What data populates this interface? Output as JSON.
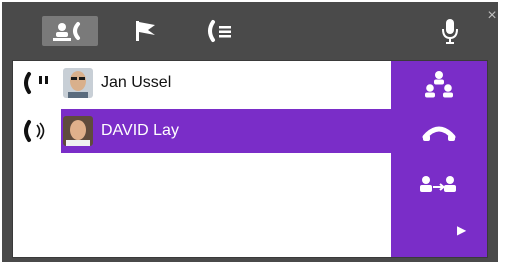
{
  "toolbar": {
    "tabs": [
      {
        "id": "contacts",
        "icon": "contacts-call-icon",
        "active": true
      },
      {
        "id": "flags",
        "icon": "flag-icon",
        "active": false
      },
      {
        "id": "call-list",
        "icon": "call-list-icon",
        "active": false
      }
    ],
    "mic_icon": "microphone-icon",
    "close_symbol": "×"
  },
  "calls": [
    {
      "name": "Jan Ussel",
      "status": "on-hold",
      "status_icon": "handset-hold-icon",
      "selected": false
    },
    {
      "name": "DAVID Lay",
      "status": "active",
      "status_icon": "handset-active-icon",
      "selected": true
    }
  ],
  "actions": [
    {
      "id": "conference",
      "icon": "conference-icon"
    },
    {
      "id": "hangup",
      "icon": "hangup-icon"
    },
    {
      "id": "transfer",
      "icon": "transfer-icon"
    },
    {
      "id": "more",
      "icon": "caret-right-icon"
    }
  ],
  "colors": {
    "accent": "#7a2dc8",
    "toolbar_bg": "#4a4a4a",
    "active_tab": "#7a7a7a"
  }
}
